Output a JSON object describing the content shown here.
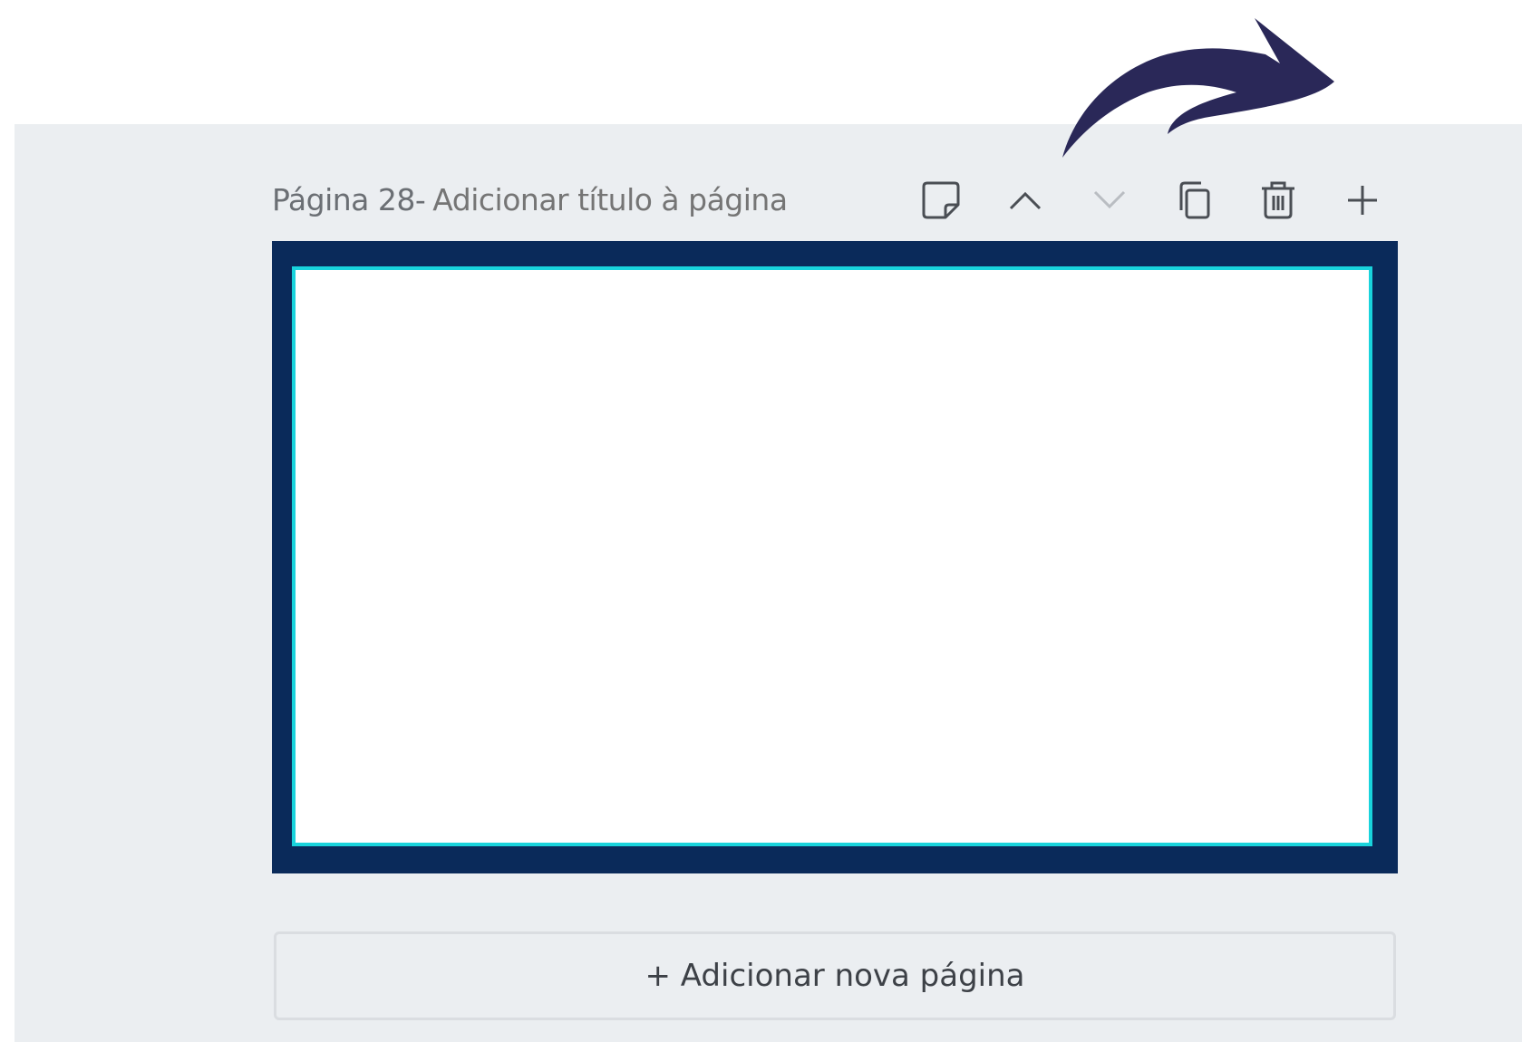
{
  "page_header": {
    "page_label": "Página 28",
    "separator": " -",
    "title_placeholder": "Adicionar título à página"
  },
  "toolbar": {
    "icons": [
      "notes-icon",
      "move-up-icon",
      "move-down-icon",
      "duplicate-icon",
      "delete-icon",
      "add-icon"
    ]
  },
  "add_page": {
    "label": "+ Adicionar nova página"
  },
  "colors": {
    "canvas_background": "#ebeef1",
    "page_border": "#0a2a5a",
    "page_inner_outline": "#19d3dc",
    "arrow": "#2a2858"
  }
}
